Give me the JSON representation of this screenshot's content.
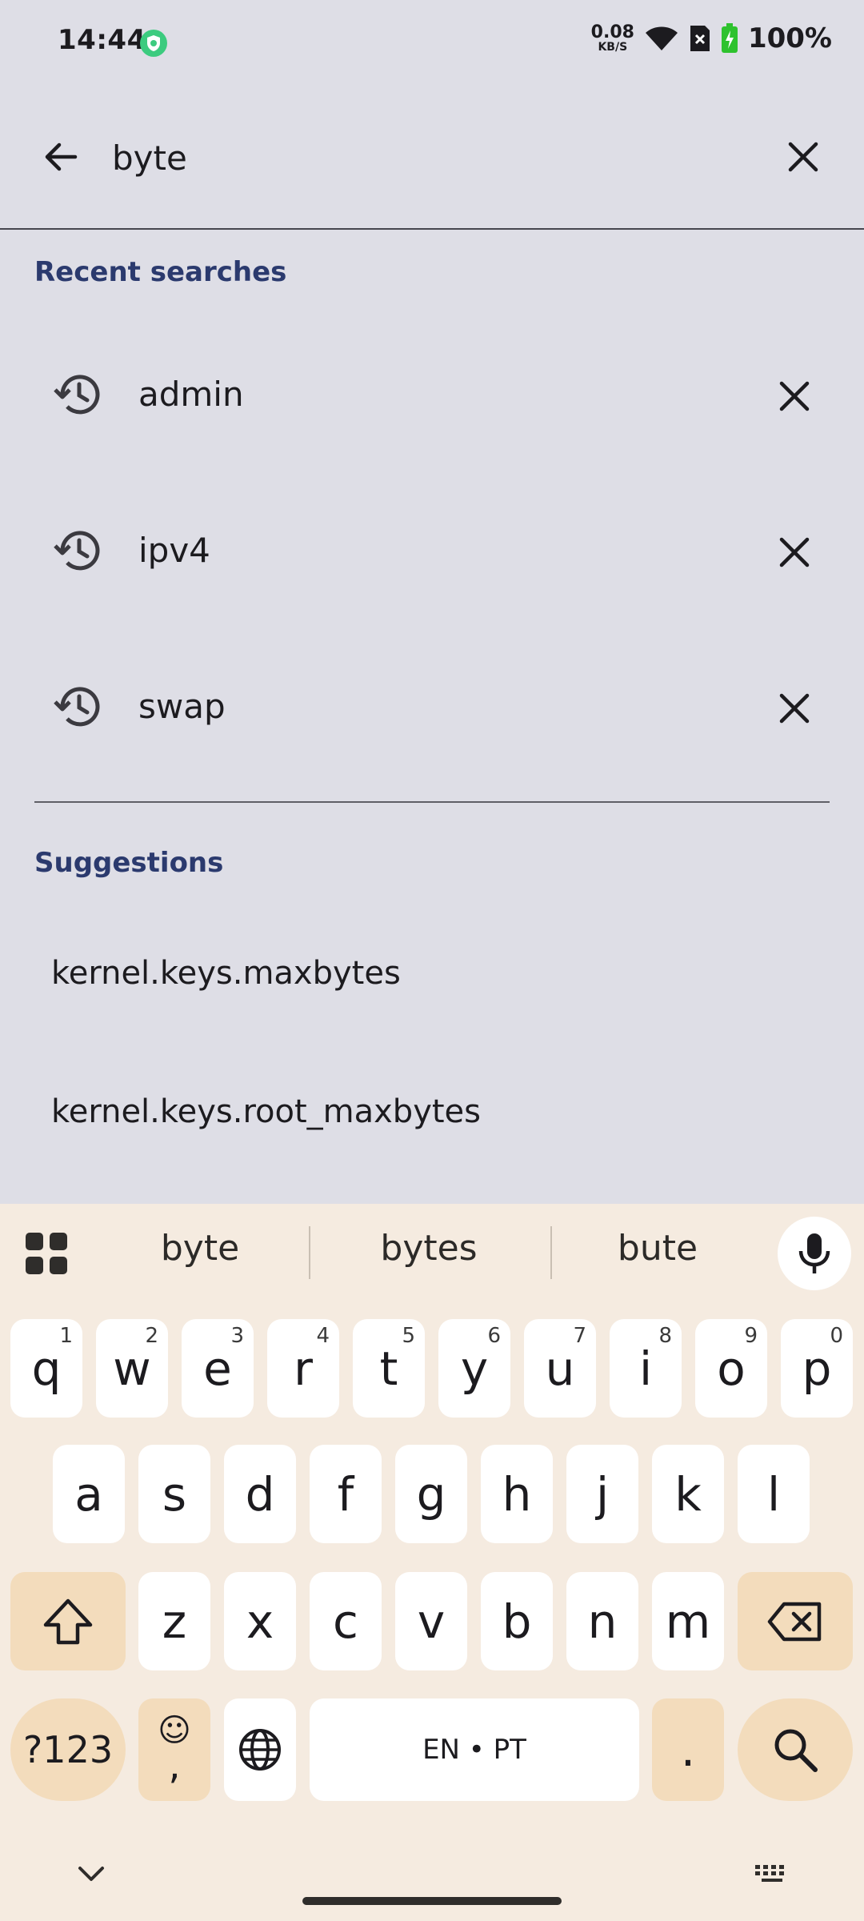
{
  "status_bar": {
    "time": "14:44",
    "net_speed_value": "0.08",
    "net_speed_unit": "KB/S",
    "battery": "100%"
  },
  "search": {
    "query": "byte"
  },
  "recent": {
    "title": "Recent searches",
    "items": [
      {
        "label": "admin"
      },
      {
        "label": "ipv4"
      },
      {
        "label": "swap"
      }
    ]
  },
  "suggestions": {
    "title": "Suggestions",
    "items": [
      {
        "label": "kernel.keys.maxbytes"
      },
      {
        "label": "kernel.keys.root_maxbytes"
      }
    ]
  },
  "keyboard": {
    "suggestions": [
      "byte",
      "bytes",
      "bute"
    ],
    "row1": [
      {
        "k": "q",
        "h": "1"
      },
      {
        "k": "w",
        "h": "2"
      },
      {
        "k": "e",
        "h": "3"
      },
      {
        "k": "r",
        "h": "4"
      },
      {
        "k": "t",
        "h": "5"
      },
      {
        "k": "y",
        "h": "6"
      },
      {
        "k": "u",
        "h": "7"
      },
      {
        "k": "i",
        "h": "8"
      },
      {
        "k": "o",
        "h": "9"
      },
      {
        "k": "p",
        "h": "0"
      }
    ],
    "row2": [
      "a",
      "s",
      "d",
      "f",
      "g",
      "h",
      "j",
      "k",
      "l"
    ],
    "row3": [
      "z",
      "x",
      "c",
      "v",
      "b",
      "n",
      "m"
    ],
    "symbols_label": "?123",
    "emoji_glyph": "☺",
    "comma_label": ",",
    "space_label": "EN • PT",
    "period_label": "."
  }
}
